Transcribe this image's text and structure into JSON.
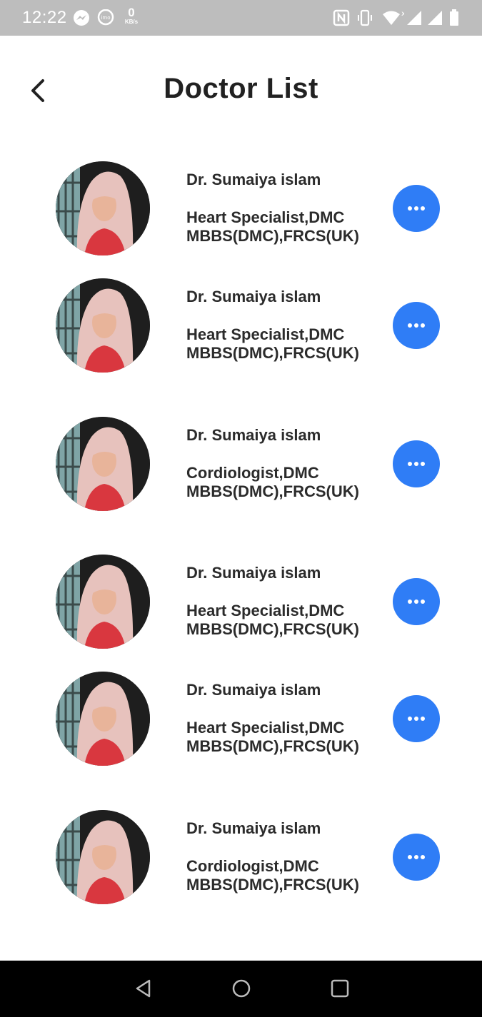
{
  "status_bar": {
    "time": "12:22",
    "net_speed_value": "0",
    "net_speed_unit": "KB/s",
    "icons": [
      "messenger-icon",
      "imo-icon",
      "nfc-icon",
      "vibrate-icon",
      "wifi-icon",
      "signal-icon",
      "signal-icon",
      "battery-icon"
    ]
  },
  "header": {
    "title": "Doctor List",
    "back_icon": "chevron-left-icon"
  },
  "doctors": [
    {
      "name": "Dr. Sumaiya islam",
      "specialty": "Heart Specialist,DMC",
      "degrees": "MBBS(DMC),FRCS(UK)"
    },
    {
      "name": "Dr. Sumaiya islam",
      "specialty": "Heart Specialist,DMC",
      "degrees": "MBBS(DMC),FRCS(UK)"
    },
    {
      "name": "Dr. Sumaiya islam",
      "specialty": "Cordiologist,DMC",
      "degrees": "MBBS(DMC),FRCS(UK)"
    },
    {
      "name": "Dr. Sumaiya islam",
      "specialty": "Heart Specialist,DMC",
      "degrees": "MBBS(DMC),FRCS(UK)"
    },
    {
      "name": "Dr. Sumaiya islam",
      "specialty": "Heart Specialist,DMC",
      "degrees": "MBBS(DMC),FRCS(UK)"
    },
    {
      "name": "Dr. Sumaiya islam",
      "specialty": "Cordiologist,DMC",
      "degrees": "MBBS(DMC),FRCS(UK)"
    }
  ],
  "row_action_icon": "more-horizontal-icon",
  "nav_bar": {
    "back_icon": "triangle-back-icon",
    "home_icon": "circle-home-icon",
    "recents_icon": "square-recents-icon"
  },
  "colors": {
    "accent": "#2f7df6",
    "status_bar": "#bdbdbd",
    "nav_bar": "#000000",
    "text": "#2b2b2b"
  }
}
